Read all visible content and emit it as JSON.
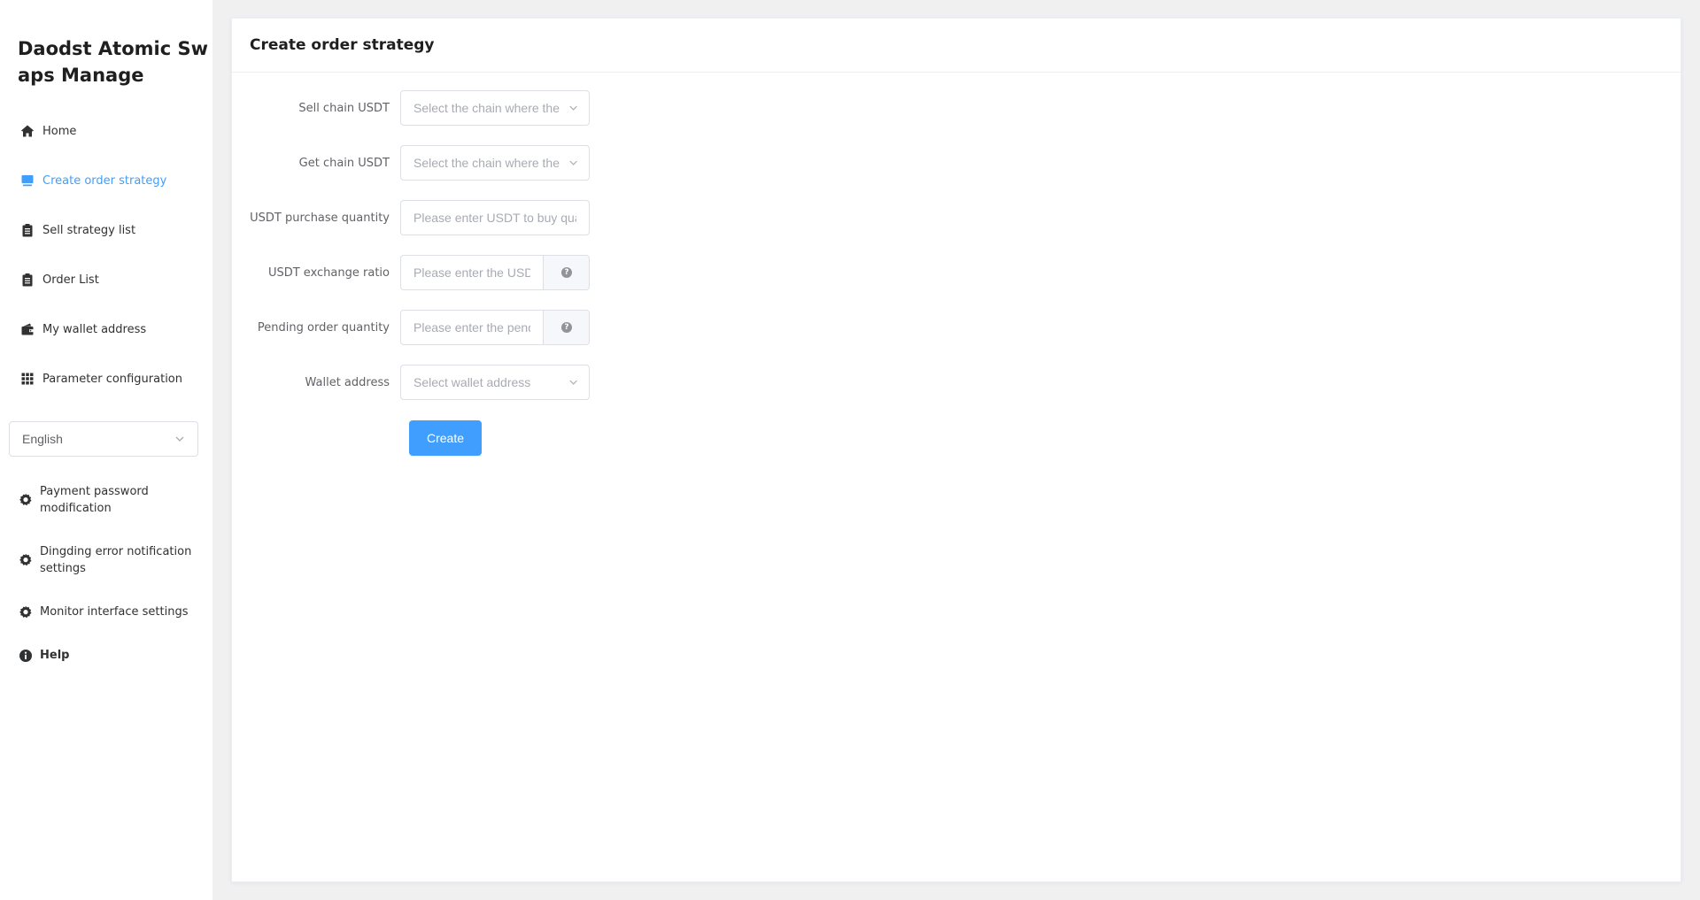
{
  "app": {
    "title": "Daodst Atomic Swaps Manage"
  },
  "sidebar": {
    "items": [
      {
        "label": "Home",
        "icon": "home-icon"
      },
      {
        "label": "Create order strategy",
        "icon": "monitor-icon",
        "active": true
      },
      {
        "label": "Sell strategy list",
        "icon": "clipboard-icon"
      },
      {
        "label": "Order List",
        "icon": "clipboard-icon"
      },
      {
        "label": "My wallet address",
        "icon": "wallet-icon"
      },
      {
        "label": "Parameter configuration",
        "icon": "grid-icon"
      }
    ],
    "language": {
      "selected": "English"
    },
    "settings": [
      {
        "label": "Payment password modification",
        "icon": "gear-icon"
      },
      {
        "label": "Dingding error notification settings",
        "icon": "gear-icon"
      },
      {
        "label": "Monitor interface settings",
        "icon": "gear-icon"
      }
    ],
    "help": {
      "label": "Help",
      "icon": "info-icon"
    }
  },
  "main": {
    "title": "Create order strategy",
    "form": {
      "sell_chain": {
        "label": "Sell chain USDT",
        "placeholder": "Select the chain where the"
      },
      "get_chain": {
        "label": "Get chain USDT",
        "placeholder": "Select the chain where the"
      },
      "purchase_quantity": {
        "label": "USDT purchase quantity",
        "placeholder": "Please enter USDT to buy qua"
      },
      "exchange_ratio": {
        "label": "USDT exchange ratio",
        "placeholder": "Please enter the USDT",
        "help_icon": "question-circle-icon"
      },
      "pending_quantity": {
        "label": "Pending order quantity",
        "placeholder": "Please enter the pending",
        "help_icon": "question-circle-icon"
      },
      "wallet_address": {
        "label": "Wallet address",
        "placeholder": "Select wallet address"
      },
      "submit_label": "Create"
    }
  },
  "colors": {
    "primary": "#409eff",
    "background": "#f0f0f0",
    "border": "#dcdfe6"
  }
}
